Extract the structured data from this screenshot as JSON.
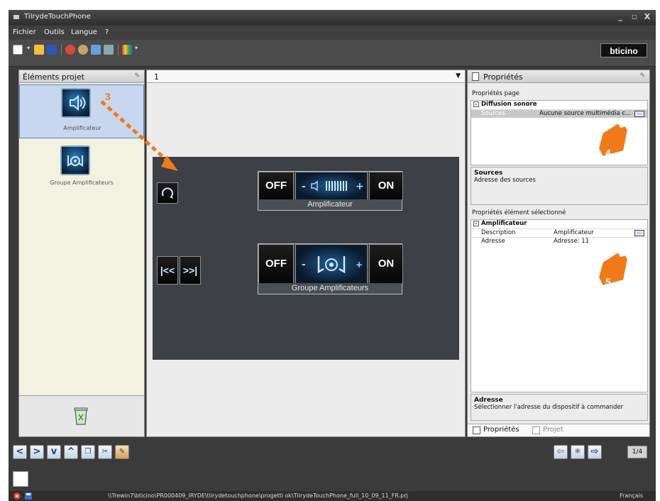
{
  "window": {
    "title": "TiIrydeTouchPhone",
    "controls": [
      "_",
      "□",
      "X"
    ]
  },
  "menu": [
    "Fichier",
    "Outils",
    "Langue",
    "?"
  ],
  "brand": {
    "logo_text": "bticino"
  },
  "left_panel": {
    "title": "Éléments projet",
    "items": [
      {
        "label": "Amplificateur",
        "icon": "speaker-icon"
      },
      {
        "label": "Groupe Amplificateurs",
        "icon": "speaker-group-icon"
      }
    ]
  },
  "page_selector": {
    "value": "1"
  },
  "panel": {
    "groups": [
      {
        "off": "OFF",
        "on": "ON",
        "caption": "Amplificateur"
      },
      {
        "off": "OFF",
        "on": "ON",
        "caption": "Groupe Amplificateurs"
      }
    ]
  },
  "properties": {
    "title": "Propriétés",
    "page_section_label": "Propriétés page",
    "page_category": "Diffusion sonore",
    "page_rows": [
      {
        "key": "Sources",
        "value": "Aucune source multimédia c..."
      }
    ],
    "sources_desc": {
      "title": "Sources",
      "text": "Adresse des sources"
    },
    "element_section_label": "Propriétés élément sélectionné",
    "element_category": "Amplificateur",
    "element_rows": [
      {
        "key": "Description",
        "value": "Amplificateur"
      },
      {
        "key": "Adresse",
        "value": "Adresse: 11"
      }
    ],
    "address_desc": {
      "title": "Adresse",
      "text": "Sélectionner l'adresse du dispositif à commander"
    },
    "tabs": [
      "Propriétés",
      "Projet"
    ]
  },
  "callouts": [
    "3",
    "4",
    "5"
  ],
  "nav": {
    "page_count": "1/4"
  },
  "status": {
    "path": "\\\\Trewin7\\bticino\\PR000409_IRYDE\\tiirydetouchphone\\progetti ok\\TiIrydeTouchPhone_full_10_09_11_FR.prj",
    "language": "Français"
  },
  "colors": {
    "accent_orange": "#f07a1a",
    "selection_blue": "#c8d7ef",
    "panel_dark": "#3d4044"
  }
}
